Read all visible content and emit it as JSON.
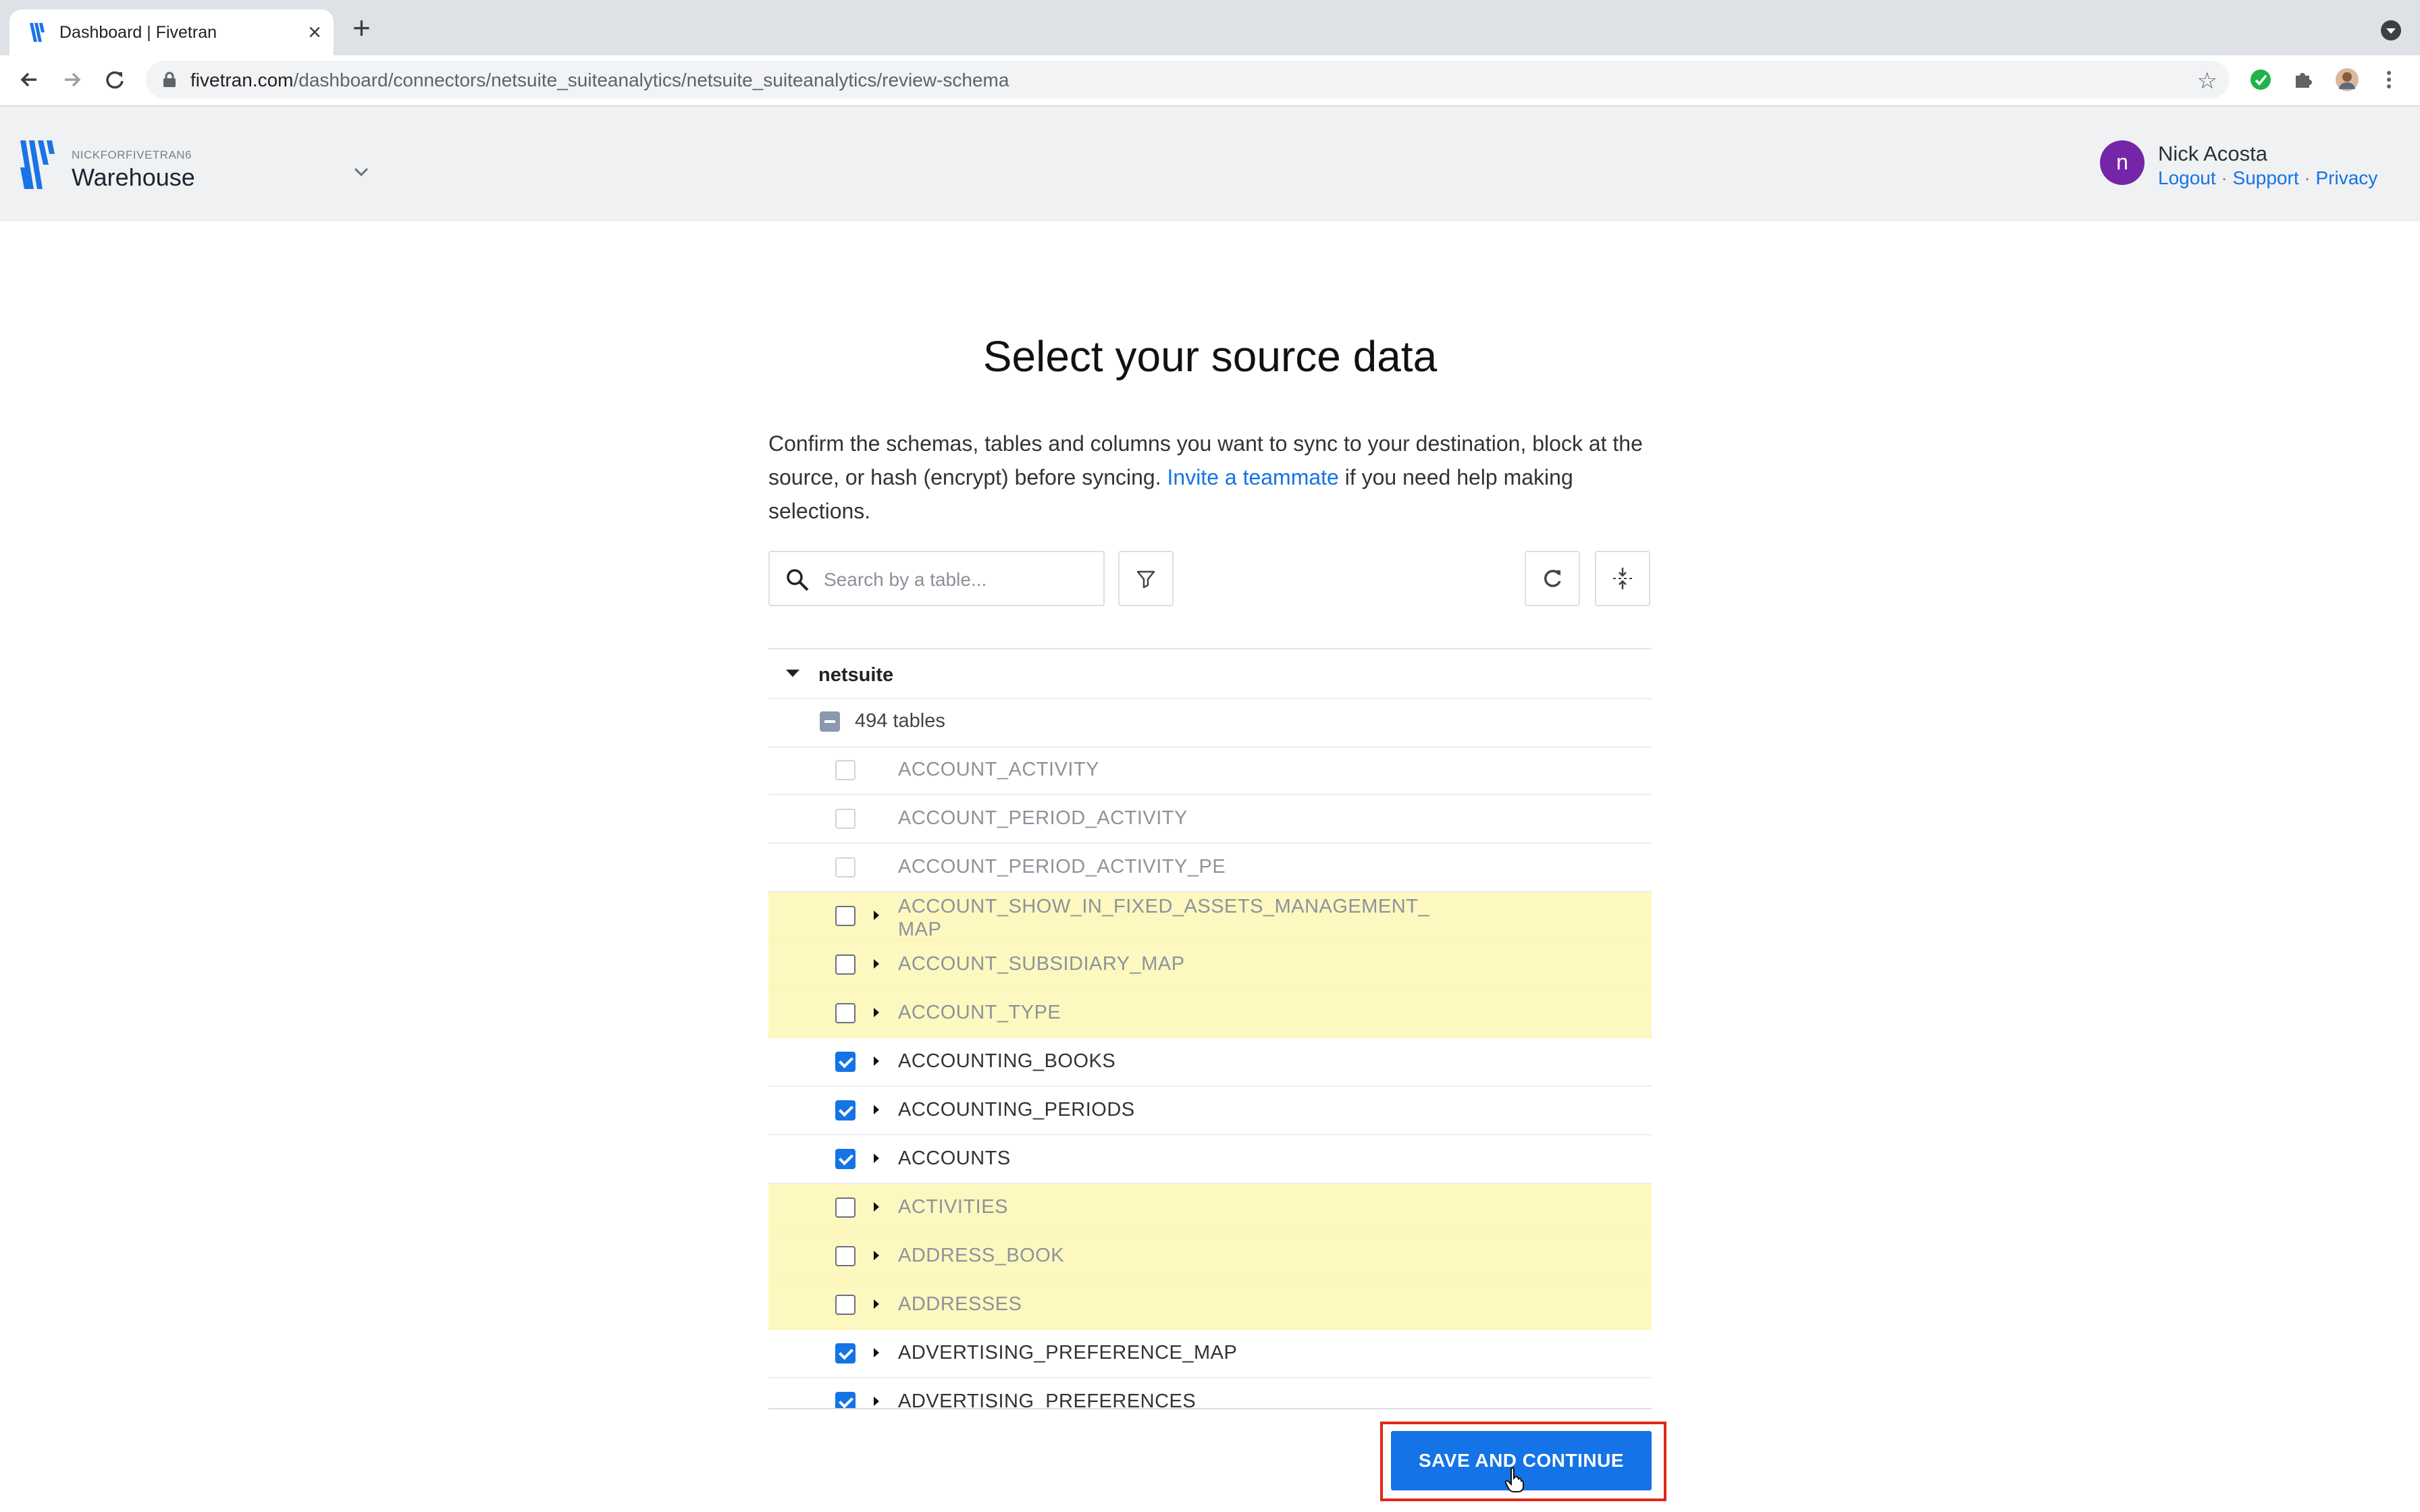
{
  "browser": {
    "tab_title": "Dashboard | Fivetran",
    "tab_close": "×",
    "new_tab": "+",
    "url_host": "fivetran.com",
    "url_path": "/dashboard/connectors/netsuite_suiteanalytics/netsuite_suiteanalytics/review-schema",
    "star": "☆"
  },
  "header": {
    "account": "NICKFORFIVETRAN6",
    "workspace": "Warehouse",
    "user_initial": "n",
    "user_name": "Nick Acosta",
    "links": {
      "logout": "Logout",
      "support": "Support",
      "privacy": "Privacy",
      "separator": " · "
    }
  },
  "main": {
    "title": "Select your source data",
    "intro_before": "Confirm the schemas, tables and columns you want to sync to your destination, block at the source, or hash (encrypt) before syncing. ",
    "intro_link": "Invite a teammate",
    "intro_after": " if you need help making selections.",
    "search_placeholder": "Search by a table...",
    "schema_name": "netsuite",
    "table_count": "494 tables",
    "save_label": "SAVE AND CONTINUE"
  },
  "tables": [
    {
      "name": "ACCOUNT_ACTIVITY",
      "state": "disabled",
      "expandable": false
    },
    {
      "name": "ACCOUNT_PERIOD_ACTIVITY",
      "state": "disabled",
      "expandable": false
    },
    {
      "name": "ACCOUNT_PERIOD_ACTIVITY_PE",
      "state": "disabled",
      "expandable": false
    },
    {
      "name": "ACCOUNT_SHOW_IN_FIXED_ASSETS_MANAGEMENT_MAP",
      "state": "blocked",
      "expandable": true
    },
    {
      "name": "ACCOUNT_SUBSIDIARY_MAP",
      "state": "blocked",
      "expandable": true
    },
    {
      "name": "ACCOUNT_TYPE",
      "state": "blocked",
      "expandable": true
    },
    {
      "name": "ACCOUNTING_BOOKS",
      "state": "checked",
      "expandable": true
    },
    {
      "name": "ACCOUNTING_PERIODS",
      "state": "checked",
      "expandable": true
    },
    {
      "name": "ACCOUNTS",
      "state": "checked",
      "expandable": true
    },
    {
      "name": "ACTIVITIES",
      "state": "blocked",
      "expandable": true
    },
    {
      "name": "ADDRESS_BOOK",
      "state": "blocked",
      "expandable": true
    },
    {
      "name": "ADDRESSES",
      "state": "blocked",
      "expandable": true
    },
    {
      "name": "ADVERTISING_PREFERENCE_MAP",
      "state": "checked",
      "expandable": true
    },
    {
      "name": "ADVERTISING_PREFERENCES",
      "state": "checked",
      "expandable": true
    }
  ],
  "colors": {
    "accent": "#1473e6",
    "blocked_row": "#fcf8bf",
    "avatar": "#7526a8",
    "highlight": "#e3261a"
  }
}
